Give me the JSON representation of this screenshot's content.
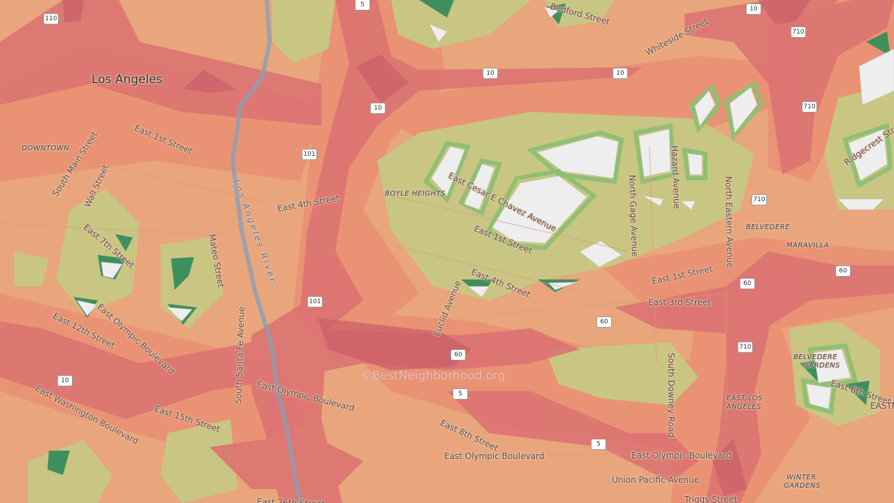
{
  "map": {
    "city_label": "Los Angeles",
    "watermark": "©BestNeighborhood.org",
    "colors": {
      "base": "#e9a57c",
      "highway_corridor": "#dc7472",
      "road_buffer": "#e98f73",
      "park_zone": "#c9c582",
      "green_ring": "#8fbf73",
      "dark_green": "#3f8f5e",
      "white_block": "#eeeeee",
      "river": "#8c9db3"
    },
    "areas": {
      "downtown": "DOWNTOWN",
      "boyle_heights": "BOYLE HEIGHTS",
      "belvedere": "BELVEDERE",
      "maravilla": "MARAVILLA",
      "belvedere_gardens_1": "BELVEDERE",
      "belvedere_gardens_2": "GARDENS",
      "east_la_1": "EAST LOS",
      "east_la_2": "ANGELES",
      "winter_gardens_1": "WINTER",
      "winter_gardens_2": "GARDENS"
    },
    "river": "Los Angeles River",
    "streets": {
      "e1st_west": "East 1st Street",
      "south_main": "South Main Street",
      "wall": "Wall Street",
      "e7th": "East 7th Street",
      "mateo": "Mateo Street",
      "e4th_west": "East 4th Street",
      "e12th": "East 12th Street",
      "olympic_1": "East Olympic Boulevard",
      "washington": "East Washington Boulevard",
      "e15th": "East 15th Street",
      "santa_fe": "South Santa Fe Avenue",
      "olympic_2": "East Olympic Boulevard",
      "e26th": "East 26th Street",
      "bedford": "Bedford Street",
      "whiteside": "Whiteside Street",
      "chavez": "East Cesar E Chavez Avenue",
      "e1st_mid": "East 1st Street",
      "e4th_mid": "East 4th Street",
      "euclid": "Euclid Avenue",
      "gage": "North Gage Avenue",
      "hazard": "Hazard Avenue",
      "eastern": "North Eastern Avenue",
      "ridgecrest": "Ridgecrest Street",
      "e1st_east": "East 1st Street",
      "e3rd": "East 3rd Street",
      "downey": "South Downey Road",
      "e8th": "East 8th Street",
      "olympic_3": "East Olympic Boulevard",
      "olympic_4": "East Olympic Boulevard",
      "union_pacific": "Union Pacific Avenue",
      "e6th": "East 6th Street",
      "eastm": "EASTM",
      "triggs": "Triggs Street"
    },
    "shields": [
      "110",
      "5",
      "10",
      "710",
      "10",
      "10",
      "101",
      "710",
      "710",
      "60",
      "60",
      "60",
      "101",
      "60",
      "710",
      "10",
      "5",
      "5",
      "10"
    ]
  }
}
